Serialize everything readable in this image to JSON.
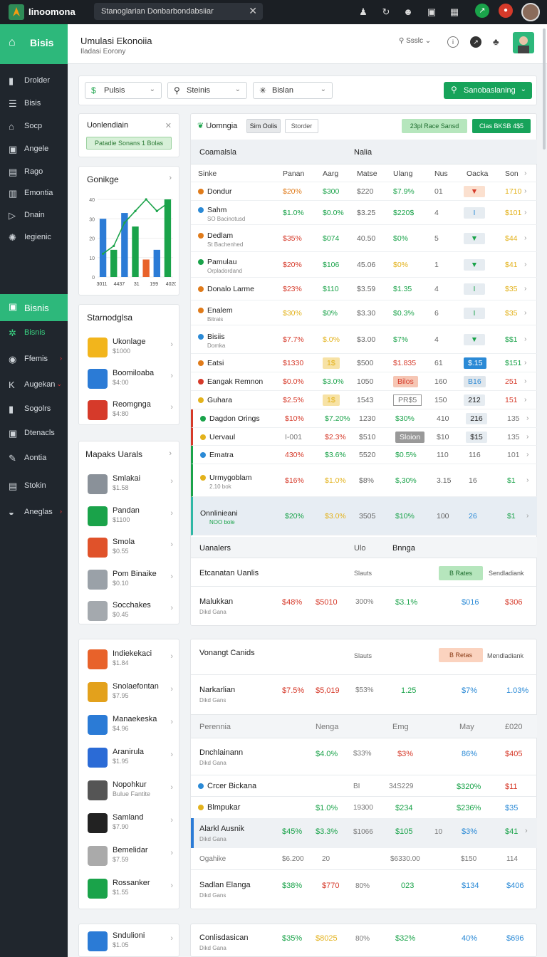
{
  "topbar": {
    "app_name": "Iinoomona",
    "search_text": "Stanoglarian Donbarbondabsiiar",
    "close_glyph": "✕"
  },
  "sidebar": {
    "brand": "Bisis",
    "items": [
      {
        "label": "Drolder",
        "icon": "file-icon"
      },
      {
        "label": "Bisis",
        "icon": "list-icon"
      },
      {
        "label": "Socp",
        "icon": "home-icon"
      },
      {
        "label": "Angele",
        "icon": "box-icon"
      },
      {
        "label": "Rago",
        "icon": "doc-icon"
      },
      {
        "label": "Emontia",
        "icon": "chart-icon"
      },
      {
        "label": "Dnain",
        "icon": "arrow-icon"
      },
      {
        "label": "Iegienic",
        "icon": "gear-icon"
      }
    ],
    "section": "Bisnis",
    "section_items": [
      {
        "label": "Bisnis",
        "icon": "sparkle-icon",
        "active": true
      },
      {
        "label": "Ffemis",
        "icon": "circle-icon",
        "red": "›"
      },
      {
        "label": "Augekan",
        "icon": "k-icon",
        "red": "⌄"
      },
      {
        "label": "Sogolrs",
        "icon": "file-icon"
      },
      {
        "label": "Dtenacls",
        "icon": "box-icon"
      },
      {
        "label": "Aontia",
        "icon": "edit-icon"
      },
      {
        "label": "Stokin",
        "icon": "doc-icon"
      },
      {
        "label": "Aneglas",
        "icon": "gauge-icon",
        "red": "›"
      }
    ]
  },
  "header": {
    "title": "Umulasi Ekonoiia",
    "subtitle": "Iladasi Eorony",
    "search_label": "Ssslc"
  },
  "filters": {
    "f1": "Pulsis",
    "f2": "Steinis",
    "f3": "Bislan",
    "primary": "Sanobaslaning"
  },
  "panel_top": {
    "title": "Uonlendiain",
    "button": "Patadie Sonans 1 Bolas"
  },
  "chart_data": {
    "type": "bar",
    "title": "Gonikge",
    "categories": [
      "3011",
      "4437",
      "31",
      "199",
      "4020"
    ],
    "values": [
      30,
      14,
      33,
      26,
      9,
      14,
      40
    ],
    "line": [
      12,
      16,
      28,
      34,
      40,
      34,
      38
    ],
    "ylim": [
      0,
      40
    ],
    "yticks": [
      "40",
      "30",
      "20",
      "10",
      "0"
    ],
    "xticks": [
      "3011",
      "4437",
      "31",
      "199",
      "4020"
    ],
    "colors": [
      "#2b7bd6",
      "#1aa34a",
      "#2b7bd6",
      "#1aa34a",
      "#e8622a",
      "#2b7bd6",
      "#1aa34a"
    ]
  },
  "card_a": {
    "title": "Starnodglsa",
    "items": [
      {
        "t": "Ukonlage",
        "s": "$1000",
        "color": "#f2b51c"
      },
      {
        "t": "Boomiloaba",
        "s": "$4:00",
        "color": "#2b7bd6"
      },
      {
        "t": "Reomgnga",
        "s": "$4:80",
        "color": "#d63a2a"
      }
    ]
  },
  "card_b": {
    "title": "Mapaks Uarals",
    "items": [
      {
        "t": "Smlakai",
        "s": "$1.58",
        "color": "#8a9199"
      },
      {
        "t": "Pandan",
        "s": "$1100",
        "color": "#1aa34a"
      },
      {
        "t": "Smola",
        "s": "$0.55",
        "color": "#e0522a"
      },
      {
        "t": "Pom Binaike",
        "s": "$0.10",
        "color": "#9aa1a8"
      },
      {
        "t": "Socchakes",
        "s": "$0.45",
        "color": "#a4a9ae"
      }
    ]
  },
  "card_c": {
    "items": [
      {
        "t": "Indiekekaci",
        "s": "$1.84",
        "color": "#e8622a"
      },
      {
        "t": "Snolaefontan",
        "s": "$7.95",
        "color": "#e3a11c"
      },
      {
        "t": "Manaekeska",
        "s": "$4.96",
        "color": "#2b7bd6"
      },
      {
        "t": "Aranirula",
        "s": "$1.95",
        "color": "#2b6bd6"
      },
      {
        "t": "Nopohkur",
        "s": "Bulue Fantite",
        "color": "#555"
      },
      {
        "t": "Samland",
        "s": "$7.90",
        "color": "#222"
      },
      {
        "t": "Bemelidar",
        "s": "$7.59",
        "color": "#aaa"
      },
      {
        "t": "Rossanker",
        "s": "$1.55",
        "color": "#1aa34a"
      }
    ]
  },
  "card_d": {
    "items": [
      {
        "t": "Sndulioni",
        "s": "$1.05",
        "color": "#2b7bd6"
      }
    ]
  },
  "table": {
    "tab_title": "Uomngia",
    "tab1": "Sim Oolis",
    "tab2": "Storder",
    "btn_green_light": "23pl Race Sansd",
    "btn_green": "Clas BKSB 4$5",
    "sub_a": "Coamalsla",
    "sub_b": "Nalia",
    "headers": [
      "Sinke",
      "Panan",
      "Aarg",
      "Matse",
      "Ulang",
      "Nus",
      "Oacka",
      "Son"
    ],
    "rows": [
      {
        "n": "Dondur",
        "c1": "$20%",
        "c2": "$300",
        "c3": "$220",
        "c4": "$7.9%",
        "c5": "01",
        "c6": "▼",
        "c7": "1710",
        "dot": "#e07b1a",
        "c1c": "o",
        "c2c": "g",
        "c4c": "g",
        "c6bg": "#fbe0cf",
        "c6c": "#d63a2a",
        "c7c": "y"
      },
      {
        "n": "Sahm",
        "sub": "SO Bacinotusd",
        "c1": "$1.0%",
        "c2": "$0.0%",
        "c3": "$3.25",
        "c4": "$220$",
        "c5": "4",
        "c6": "I",
        "c7": "$101",
        "dot": "#2b8ad6",
        "c1c": "g",
        "c2c": "g",
        "c4c": "g",
        "c6bg": "#e6ecf1",
        "c6c": "#2b8ad6",
        "c7c": "y"
      },
      {
        "n": "Dedlam",
        "sub": "St Bachenhed",
        "c1": "$35%",
        "c2": "$074",
        "c3": "40.50",
        "c4": "$0%",
        "c5": "5",
        "c6": "▼",
        "c7": "$44",
        "dot": "#e07b1a",
        "c1c": "r",
        "c2c": "g",
        "c4c": "g",
        "c6bg": "#e6ecf1",
        "c6c": "#1aa34a",
        "c7c": "y"
      },
      {
        "n": "Pamulau",
        "sub": "Orpladordand",
        "c1": "$20%",
        "c2": "$106",
        "c3": "45.06",
        "c4": "$0%",
        "c5": "1",
        "c6": "▼",
        "c7": "$41",
        "dot": "#1aa34a",
        "c1c": "r",
        "c2c": "g",
        "c4c": "y",
        "c6bg": "#e6ecf1",
        "c6c": "#1aa34a",
        "c7c": "y"
      },
      {
        "n": "Donalo Larme",
        "c1": "$23%",
        "c2": "$110",
        "c3": "$3.59",
        "c4": "$1.35",
        "c5": "4",
        "c6": "I",
        "c7": "$35",
        "dot": "#e07b1a",
        "c1c": "r",
        "c2c": "g",
        "c4c": "g",
        "c6bg": "#e6ecf1",
        "c6c": "#1aa34a",
        "c7c": "y"
      },
      {
        "n": "Enalem",
        "sub": "Bitrais",
        "c1": "$30%",
        "c2": "$0%",
        "c3": "$3.30",
        "c4": "$0.3%",
        "c5": "6",
        "c6": "I",
        "c7": "$35",
        "dot": "#e07b1a",
        "c1c": "y",
        "c2c": "g",
        "c4c": "g",
        "c6bg": "#e6ecf1",
        "c6c": "#1aa34a",
        "c7c": "y"
      },
      {
        "n": "Bisiis",
        "sub": "Domka",
        "c1": "$7.7%",
        "c2": "$.0%",
        "c3": "$3.00",
        "c4": "$7%",
        "c5": "4",
        "c6": "▼",
        "c7": "$$1",
        "dot": "#2b8ad6",
        "c1c": "r",
        "c2c": "y",
        "c4c": "g",
        "c6bg": "#e6ecf1",
        "c6c": "#1aa34a",
        "c7c": "g"
      },
      {
        "n": "Eatsi",
        "c1": "$1330",
        "c2": "1$",
        "c3": "$500",
        "c4": "$1.835",
        "c5": "61",
        "c6": "$.15",
        "c7": "$151",
        "dot": "#e07b1a",
        "c1c": "r",
        "c2c": "y",
        "c4c": "r",
        "c6bg": "#2b8ad6",
        "c6c": "#fff",
        "c7c": "g",
        "c2bg": "#f7e2a5"
      },
      {
        "n": "Eangak Remnon",
        "c1": "$0.0%",
        "c2": "$3.0%",
        "c3": "1050",
        "c4": "Bilos",
        "c5": "160",
        "c6": "B16",
        "c7": "251",
        "dot": "#d63a2a",
        "c1c": "r",
        "c2c": "g",
        "c4c": "r",
        "c4bg": "#f6c6b4",
        "c6bg": "#dfe6ec",
        "c6c": "#2b8ad6",
        "c7c": "r"
      },
      {
        "n": "Guhara",
        "c1": "$2.5%",
        "c2": "1$",
        "c3": "1543",
        "c4": "PR$5",
        "c5": "150",
        "c6": "212",
        "c7": "151",
        "dot": "#e3b21c",
        "c1c": "r",
        "c2c": "y",
        "c4c": "gr",
        "c2bg": "#f7e2a5",
        "c4bd": "#999",
        "c6bg": "#e6ecf1",
        "c6c": "#222",
        "c7c": "r"
      },
      {
        "n": "Dagdon Orings",
        "c1": "$10%",
        "c2": "$7.20%",
        "c3": "1230",
        "c4": "$30%",
        "c5": "410",
        "c6": "216",
        "c7": "135",
        "dot": "#1aa34a",
        "c1c": "r",
        "c2c": "g",
        "c4c": "g",
        "c6bg": "#e6ecf1",
        "c6c": "#222",
        "c7c": "gr",
        "bar": "#d63a2a"
      },
      {
        "n": "Uervaul",
        "c1": "I-001",
        "c2": "$2.3%",
        "c3": "$510",
        "c4": "Sloion",
        "c5": "$10",
        "c6": "$15",
        "c7": "135",
        "dot": "#e3b21c",
        "c1c": "gr",
        "c2c": "r",
        "c4c": "fff",
        "c4bg": "#999",
        "c6bg": "#e6ecf1",
        "c6c": "#222",
        "c7c": "gr",
        "bar": "#d63a2a"
      },
      {
        "n": "Ematra",
        "c1": "430%",
        "c2": "$3.6%",
        "c3": "5520",
        "c4": "$0.5%",
        "c5": "110",
        "c6": "116",
        "c7": "101",
        "dot": "#2b8ad6",
        "c1c": "r",
        "c2c": "g",
        "c4c": "g",
        "c7c": "gr",
        "bar": "#1aa34a"
      },
      {
        "n": "Urmygoblam",
        "sub": "2.10 bok",
        "c1": "$16%",
        "c2": "$1.0%",
        "c3": "$8%",
        "c4": "$,30%",
        "c5": "3.15",
        "c6": "16",
        "c7": "$1",
        "dot": "#e3b21c",
        "c1c": "r",
        "c2c": "y",
        "c4c": "g",
        "c7c": "g",
        "bar": "#1aa34a"
      },
      {
        "n": "Onnlinieani",
        "sub": "NOO bole",
        "c1": "$20%",
        "c2": "$3.0%",
        "c3": "3505",
        "c4": "$10%",
        "c5": "100",
        "c6": "26",
        "c7": "$1",
        "c1c": "g",
        "c2c": "y",
        "c4c": "g",
        "c6c": "#2b8ad6",
        "c7c": "g",
        "bar": "#2fb7a5",
        "hl": true
      }
    ]
  },
  "sec2": {
    "h1": "Uanalers",
    "h2": "Ulo",
    "h3": "Bnnga",
    "r1": "Etcanatan Uanlis",
    "r1b": "Slauts",
    "r1btn": "B Rates",
    "r1c": "Sendladiank",
    "r2": "Malukkan",
    "r2s": "Dikd Gana",
    "r2v": [
      "$48%",
      "$5010",
      "300%",
      "$3.1%",
      "$016",
      "$306"
    ]
  },
  "sec3": {
    "r1": "Vonangt Canids",
    "r1b": "Slauts",
    "r1btn": "B Retas",
    "r1c": "Mendladiank",
    "r2": "Narkarlian",
    "r2s": "Dikd Gans",
    "r2v": [
      "$7.5%",
      "$5,019",
      "$53%",
      "1.25",
      "$7%",
      "1.03%"
    ],
    "hdrs": [
      "Perennia",
      "Nenga",
      "Emg",
      "May",
      "£020"
    ],
    "r3": "Dnchlainann",
    "r3s": "Dikd Gana",
    "r3v": [
      "$4.0%",
      "$33%",
      "$3%",
      "86%",
      "$405"
    ],
    "r4": "Crcer Bickana",
    "r4v": [
      "BI",
      "34S229",
      "$320%",
      "$11"
    ],
    "r5": "Blmpukar",
    "r5v": [
      "$1.0%",
      "19300",
      "$234",
      "$236%",
      "$35"
    ],
    "r6": "Alarkl Ausnik",
    "r6s": "Dikd Gana",
    "r6v": [
      "$45%",
      "$3.3%",
      "$1066",
      "$105",
      "10",
      "$3%",
      "$41"
    ],
    "r7": "Ogahike",
    "r7v": [
      "$6.200",
      "20",
      "$6330.00",
      "$150",
      "114"
    ],
    "r8": "Sadlan Elanga",
    "r8s": "Dikd Gans",
    "r8v": [
      "$38%",
      "$770",
      "80%",
      "023",
      "$134",
      "$406"
    ]
  },
  "sec4": {
    "r": "Conlisdasican",
    "rs": "Dikd Gana",
    "rv": [
      "$35%",
      "$8025",
      "80%",
      "$32%",
      "40%",
      "$696"
    ]
  }
}
